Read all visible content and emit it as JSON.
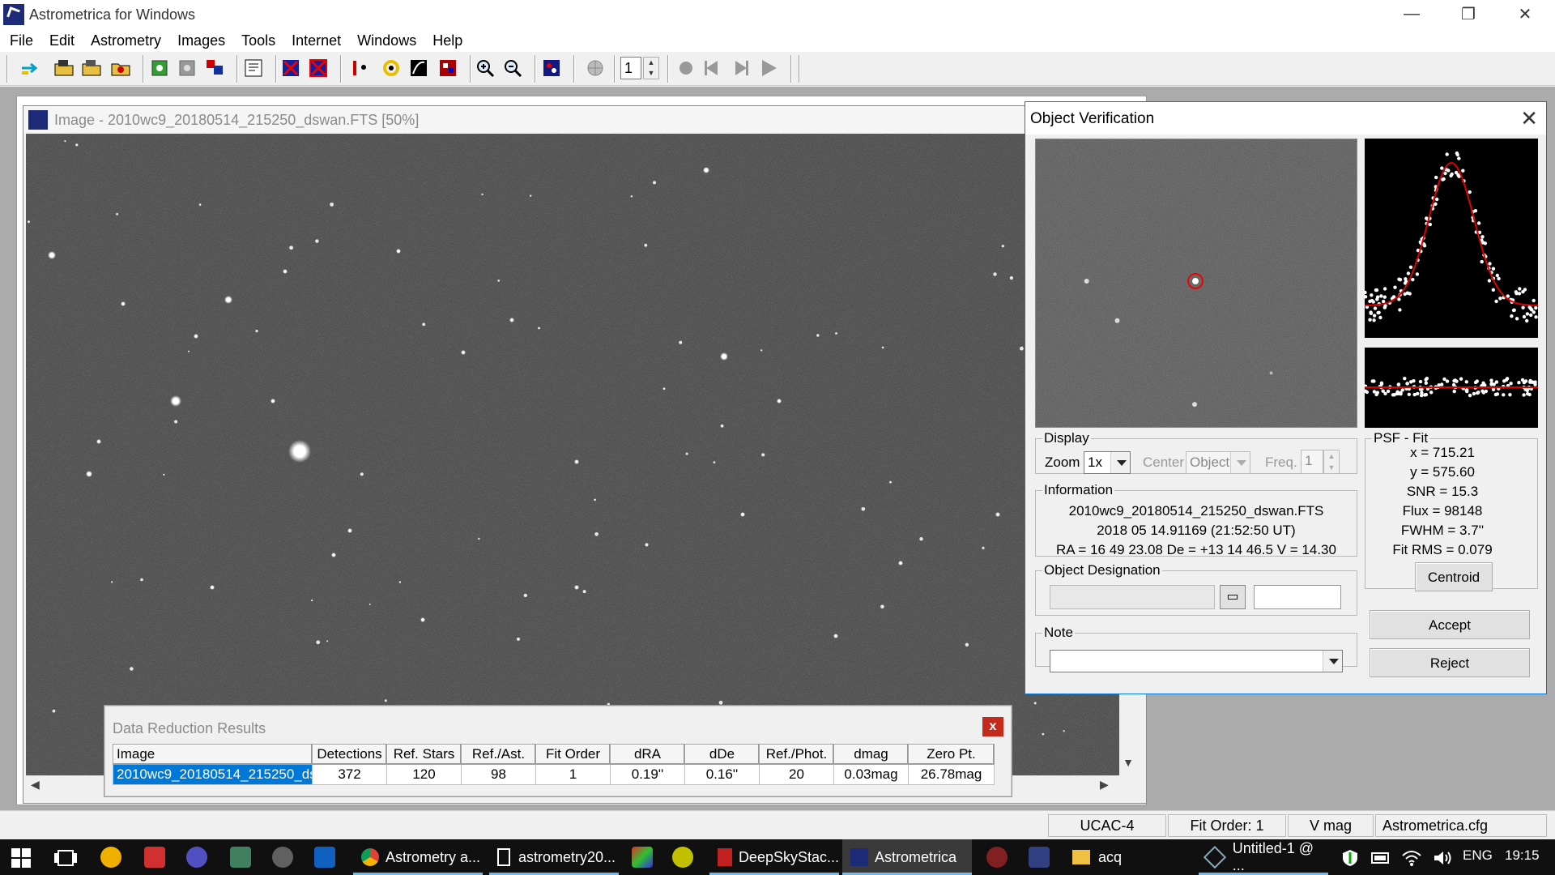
{
  "window": {
    "title": "Astrometrica for Windows",
    "minimize": "—",
    "restore": "❐",
    "close": "✕"
  },
  "menu": [
    "File",
    "Edit",
    "Astrometry",
    "Images",
    "Tools",
    "Internet",
    "Windows",
    "Help"
  ],
  "toolbar": {
    "spin_value": "1",
    "icons": [
      "go-icon",
      "open-folder-icon",
      "open-folder-2-icon",
      "open-folder-3-icon",
      "settings-green-icon",
      "settings-gray-icon",
      "blink-icon",
      "load-catalog-icon",
      "star-marker-icon",
      "remove-marker-icon",
      "moving-object-icon",
      "circle-target-icon",
      "tracking-icon",
      "color-image-icon",
      "zoom-in-icon",
      "zoom-out-icon",
      "data-icon",
      "globe-icon"
    ]
  },
  "image_window": {
    "title": "Image - 2010wc9_20180514_215250_dswan.FTS [50%]"
  },
  "data_reduction": {
    "title": "Data Reduction Results",
    "close": "x",
    "columns": [
      "Image",
      "Detections",
      "Ref. Stars",
      "Ref./Ast.",
      "Fit Order",
      "dRA",
      "dDe",
      "Ref./Phot.",
      "dmag",
      "Zero Pt."
    ],
    "row": [
      "2010wc9_20180514_215250_ds",
      "372",
      "120",
      "98",
      "1",
      "0.19''",
      "0.16''",
      "20",
      "0.03mag",
      "26.78mag"
    ]
  },
  "object_verification": {
    "title": "Object Verification",
    "close": "✕",
    "display": {
      "legend": "Display",
      "zoom_label": "Zoom",
      "zoom_value": "1x",
      "center_label": "Center",
      "center_value": "Object",
      "freq_label": "Freq.",
      "freq_value": "1"
    },
    "information": {
      "legend": "Information",
      "file": "2010wc9_20180514_215250_dswan.FTS",
      "date": "2018 05 14.91169 (21:52:50 UT)",
      "coords": "RA = 16 49 23.08   De = +13 14 46.5   V = 14.30"
    },
    "designation": {
      "legend": "Object Designation",
      "value1": "",
      "value2": ""
    },
    "note": {
      "legend": "Note",
      "value": ""
    },
    "psf_fit": {
      "legend": "PSF - Fit",
      "lines": [
        "x = 715.21",
        "y = 575.60",
        "SNR = 15.3",
        "Flux = 98148",
        "FWHM = 3.7''",
        "Fit RMS = 0.079"
      ],
      "centroid_button": "Centroid"
    },
    "accept_button": "Accept",
    "reject_button": "Reject"
  },
  "status_bar": {
    "catalog": "UCAC-4",
    "fit_order": "Fit Order: 1",
    "mag_band": "V mag",
    "config": "Astrometrica.cfg"
  },
  "taskbar": {
    "apps": [
      "Astrometry a...",
      "astrometry20...",
      "DeepSkyStac...",
      "Astrometrica",
      "acq",
      "Untitled-1 @ ..."
    ],
    "language": "ENG",
    "time": "19:15"
  },
  "colors": {
    "accent": "#0078d7",
    "close_red": "#c42b1c",
    "psf_curve": "#e00000",
    "taskbar": "#101010"
  }
}
